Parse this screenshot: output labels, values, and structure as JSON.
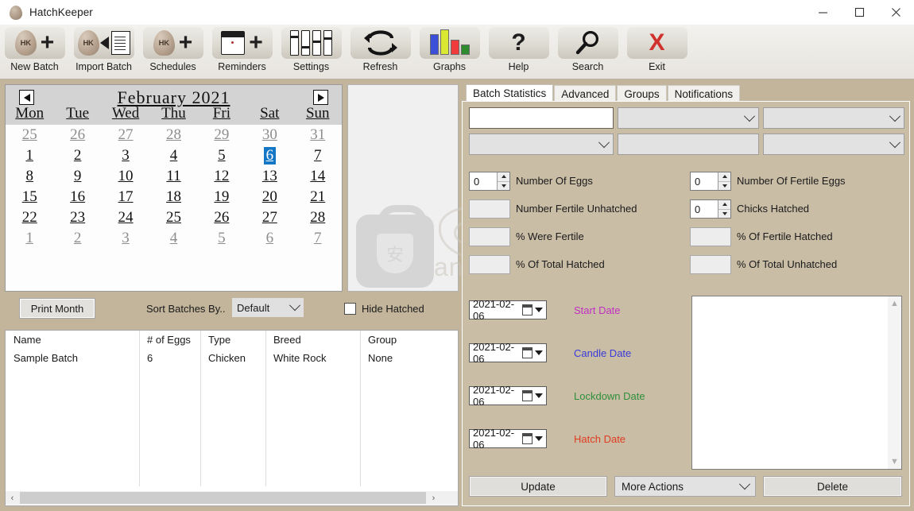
{
  "window": {
    "title": "HatchKeeper",
    "app_icon": "egg-icon",
    "controls": {
      "minimize": "minimize-icon",
      "maximize": "maximize-icon",
      "close": "close-icon"
    }
  },
  "toolbar": {
    "buttons": [
      {
        "label": "New Batch",
        "icon": "egg-plus-icon"
      },
      {
        "label": "Import Batch",
        "icon": "egg-import-document-icon"
      },
      {
        "label": "Schedules",
        "icon": "cracked-egg-plus-icon"
      },
      {
        "label": "Reminders",
        "icon": "calendar-plus-icon"
      },
      {
        "label": "Settings",
        "icon": "sliders-icon"
      },
      {
        "label": "Refresh",
        "icon": "refresh-arrows-icon"
      },
      {
        "label": "Graphs",
        "icon": "bar-chart-icon"
      },
      {
        "label": "Help",
        "icon": "question-mark-icon"
      },
      {
        "label": "Search",
        "icon": "magnifier-icon"
      },
      {
        "label": "Exit",
        "icon": "red-x-icon"
      }
    ]
  },
  "calendar": {
    "month_title": "February 2021",
    "prev_label": "◀",
    "next_label": "▶",
    "day_headers": [
      "Mon",
      "Tue",
      "Wed",
      "Thu",
      "Fri",
      "Sat",
      "Sun"
    ],
    "selected_day": 6,
    "weeks": [
      [
        {
          "d": "25",
          "m": true
        },
        {
          "d": "26",
          "m": true
        },
        {
          "d": "27",
          "m": true
        },
        {
          "d": "28",
          "m": true
        },
        {
          "d": "29",
          "m": true
        },
        {
          "d": "30",
          "m": true
        },
        {
          "d": "31",
          "m": true
        }
      ],
      [
        {
          "d": "1"
        },
        {
          "d": "2"
        },
        {
          "d": "3"
        },
        {
          "d": "4"
        },
        {
          "d": "5"
        },
        {
          "d": "6",
          "sel": true
        },
        {
          "d": "7"
        }
      ],
      [
        {
          "d": "8"
        },
        {
          "d": "9"
        },
        {
          "d": "10"
        },
        {
          "d": "11"
        },
        {
          "d": "12"
        },
        {
          "d": "13"
        },
        {
          "d": "14"
        }
      ],
      [
        {
          "d": "15"
        },
        {
          "d": "16"
        },
        {
          "d": "17"
        },
        {
          "d": "18"
        },
        {
          "d": "19"
        },
        {
          "d": "20"
        },
        {
          "d": "21"
        }
      ],
      [
        {
          "d": "22"
        },
        {
          "d": "23"
        },
        {
          "d": "24"
        },
        {
          "d": "25"
        },
        {
          "d": "26"
        },
        {
          "d": "27"
        },
        {
          "d": "28"
        }
      ],
      [
        {
          "d": "1",
          "m": true
        },
        {
          "d": "2",
          "m": true
        },
        {
          "d": "3",
          "m": true
        },
        {
          "d": "4",
          "m": true
        },
        {
          "d": "5",
          "m": true
        },
        {
          "d": "6",
          "m": true
        },
        {
          "d": "7",
          "m": true
        }
      ]
    ]
  },
  "watermark": {
    "glyph": "安",
    "text": "anxz.com"
  },
  "left_controls": {
    "print_month": "Print Month",
    "sort_label": "Sort Batches By..",
    "sort_value": "Default",
    "hide_hatched_label": "Hide Hatched",
    "hide_hatched_checked": false
  },
  "batch_table": {
    "columns": [
      "Name",
      "# of Eggs",
      "Type",
      "Breed",
      "Group"
    ],
    "rows": [
      {
        "name": "Sample Batch",
        "eggs": "6",
        "type": "Chicken",
        "breed": "White Rock",
        "group": "None"
      }
    ],
    "scroll_left": "‹",
    "scroll_right": "›"
  },
  "right_panel": {
    "tabs": [
      {
        "label": "Batch Statistics",
        "active": true
      },
      {
        "label": "Advanced",
        "active": false
      },
      {
        "label": "Groups",
        "active": false
      },
      {
        "label": "Notifications",
        "active": false
      }
    ],
    "fields_row1": [
      {
        "kind": "textbox",
        "value": ""
      },
      {
        "kind": "combo",
        "value": ""
      },
      {
        "kind": "combo",
        "value": ""
      }
    ],
    "fields_row2": [
      {
        "kind": "combo",
        "value": ""
      },
      {
        "kind": "plain",
        "value": ""
      },
      {
        "kind": "combo",
        "value": ""
      }
    ],
    "stats": [
      {
        "label": "Number Of Eggs",
        "kind": "spin",
        "value": "0"
      },
      {
        "label": "Number Of Fertile Eggs",
        "kind": "spin",
        "value": "0"
      },
      {
        "label": "Number Fertile Unhatched",
        "kind": "readonly",
        "value": ""
      },
      {
        "label": "Chicks Hatched",
        "kind": "spin",
        "value": "0"
      },
      {
        "label": "% Were Fertile",
        "kind": "readonly",
        "value": ""
      },
      {
        "label": "% Of Fertile Hatched",
        "kind": "readonly",
        "value": ""
      },
      {
        "label": "% Of Total Hatched",
        "kind": "readonly",
        "value": ""
      },
      {
        "label": "% Of Total Unhatched",
        "kind": "readonly",
        "value": ""
      }
    ],
    "dates": [
      {
        "label": "Start Date",
        "value": "2021-02-06",
        "color": "#c030c0"
      },
      {
        "label": "Candle Date",
        "value": "2021-02-06",
        "color": "#3a3ad8"
      },
      {
        "label": "Lockdown Date",
        "value": "2021-02-06",
        "color": "#2f8f3a"
      },
      {
        "label": "Hatch Date",
        "value": "2021-02-06",
        "color": "#e03c21"
      }
    ],
    "notes": {
      "value": "",
      "placeholder": ""
    },
    "actions": {
      "update": "Update",
      "more_actions": "More Actions",
      "delete": "Delete"
    }
  },
  "colors": {
    "app_background": "#c2b59b",
    "panel_background": "#c9bda6",
    "toolbar_background": "#eceae5",
    "selection_blue": "#1477c6"
  }
}
